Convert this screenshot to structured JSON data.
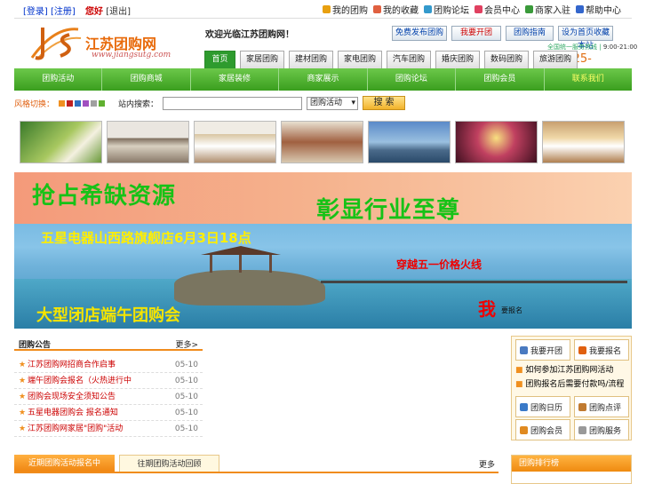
{
  "top": {
    "links": [
      "[登录]",
      "[注册]"
    ],
    "hi": "您好",
    "tag": "[退出]",
    "right": [
      {
        "label": "我的团购",
        "icon": "key-icon",
        "color": "#e8a010"
      },
      {
        "label": "我的收藏",
        "icon": "user-icon",
        "color": "#e06040"
      },
      {
        "label": "团购论坛",
        "icon": "chat-icon",
        "color": "#3399cc"
      },
      {
        "label": "会员中心",
        "icon": "heart-icon",
        "color": "#e04060"
      },
      {
        "label": "商家入驻",
        "icon": "shop-icon",
        "color": "#3a9a3a"
      },
      {
        "label": "帮助中心",
        "icon": "help-icon",
        "color": "#3366cc"
      }
    ]
  },
  "logo": {
    "name": "江苏团购网",
    "url": "www.jiangsutg.com"
  },
  "header": {
    "welcome": "欢迎光临江苏团购网！",
    "buttons": [
      "免费发布团购",
      "我要开团",
      "团购指南",
      "设为首页收藏本站"
    ],
    "hotline_label": "全国统一服务热线",
    "hotline_hours": "9:00-21:00",
    "phone": "025-"
  },
  "tabs": [
    "首页",
    "家居团购",
    "建材团购",
    "家电团购",
    "汽车团购",
    "婚庆团购",
    "数码团购",
    "旅游团购"
  ],
  "nav": [
    "团购活动",
    "团购商城",
    "家居装修",
    "商家展示",
    "团购论坛",
    "团购会员",
    "联系我们"
  ],
  "search": {
    "color_label": "风格切换：",
    "label": "站内搜索：",
    "placeholder": "",
    "select": "团购活动",
    "button": "搜 索",
    "swatches": [
      "#f09020",
      "#c02020",
      "#3070c0",
      "#a050c0",
      "#a0a0a0",
      "#60b030"
    ]
  },
  "banner": {
    "line1": "抢占希缺资源",
    "line2": "彰显行业至尊",
    "line3": "五星电器山西路旗舰店6月3日18点",
    "line4": "穿越五一价格火线",
    "line5": "大型闭店端午团购会",
    "line6": "我",
    "line7": "要报名"
  },
  "news": {
    "title": "团购公告",
    "more": "更多>",
    "items": [
      {
        "text": "江苏团购网招商合作启事",
        "date": "05-10"
      },
      {
        "text": "端午团购会报名（火热进行中",
        "date": "05-10"
      },
      {
        "text": "团购会现场安全须知公告",
        "date": "05-10"
      },
      {
        "text": "五星电器团购会 报名通知",
        "date": "05-10"
      },
      {
        "text": "江苏团购网家居\"团购\"活动",
        "date": "05-10"
      }
    ]
  },
  "side": {
    "tabs": [
      "我要开团",
      "我要报名"
    ],
    "links": [
      "如何参加江苏团购网活动",
      "团购报名后需要付款吗/流程"
    ],
    "tabs2": [
      "团购日历",
      "团购点评",
      "团购会员",
      "团购服务"
    ]
  },
  "bottom": {
    "tabs": [
      "近期团购活动报名中",
      "往期团购活动回顾"
    ],
    "more": "更多",
    "side_title": "团购排行榜"
  }
}
